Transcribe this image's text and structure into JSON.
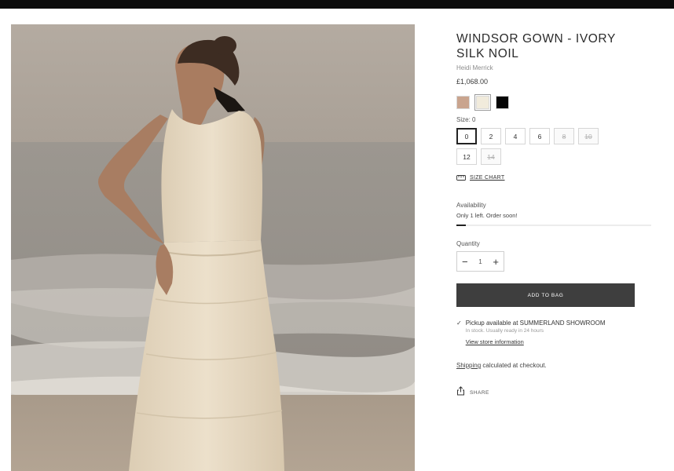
{
  "product": {
    "title": "WINDSOR GOWN - IVORY SILK NOIL",
    "brand": "Heidi Merrick",
    "price": "£1,068.00",
    "colors": [
      {
        "name": "tan",
        "hex": "#c9a48e"
      },
      {
        "name": "ivory",
        "hex": "#f1ebdc"
      },
      {
        "name": "black",
        "hex": "#050505"
      }
    ],
    "selected_color": "ivory",
    "size_label": "Size: 0",
    "sizes": [
      {
        "label": "0",
        "selected": true,
        "sold_out": false
      },
      {
        "label": "2",
        "selected": false,
        "sold_out": false
      },
      {
        "label": "4",
        "selected": false,
        "sold_out": false
      },
      {
        "label": "6",
        "selected": false,
        "sold_out": false
      },
      {
        "label": "8",
        "selected": false,
        "sold_out": true
      },
      {
        "label": "10",
        "selected": false,
        "sold_out": true
      },
      {
        "label": "12",
        "selected": false,
        "sold_out": false
      },
      {
        "label": "14",
        "selected": false,
        "sold_out": true
      }
    ],
    "size_chart_label": "SIZE CHART",
    "availability_label": "Availability",
    "availability_text": "Only 1 left. Order soon!",
    "stock_level_fraction": 0.05,
    "quantity_label": "Quantity",
    "quantity_value": "1",
    "minus_label": "−",
    "plus_label": "+",
    "add_to_bag_label": "ADD TO BAG",
    "pickup": {
      "line1": "Pickup available at SUMMERLAND SHOWROOM",
      "line2": "In stock. Usually ready in 24 hours",
      "link": "View store information"
    },
    "shipping": {
      "link": "Shipping",
      "text": " calculated at checkout."
    },
    "share_label": "SHARE"
  },
  "colors": {
    "top_bar": "#0b0b0b",
    "button_bg": "#3e3e3e",
    "text_main": "#2b2b2b"
  },
  "icons": [
    "ruler-icon",
    "check-icon",
    "share-icon"
  ]
}
